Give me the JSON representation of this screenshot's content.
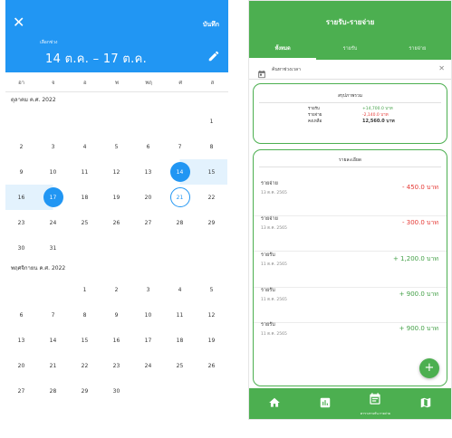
{
  "picker": {
    "header": {
      "close_glyph": "✕",
      "save_label": "บันทึก",
      "range_caption": "เลือกช่วง",
      "range_text": "14 ต.ค. – 17 ต.ค.",
      "edit_icon": "pencil-icon",
      "bg_color": "#2196f3"
    },
    "weekdays": [
      "อา",
      "จ",
      "อ",
      "พ",
      "พฤ",
      "ศ",
      "ส"
    ],
    "months": [
      {
        "title": "ตุลาคม ค.ศ. 2022",
        "lead_blanks": 6,
        "days": [
          "1",
          "2",
          "3",
          "4",
          "5",
          "6",
          "7",
          "8",
          "9",
          "10",
          "11",
          "12",
          "13",
          "14",
          "15",
          "16",
          "17",
          "18",
          "19",
          "20",
          "21",
          "22",
          "23",
          "24",
          "25",
          "26",
          "27",
          "28",
          "29",
          "30",
          "31"
        ]
      },
      {
        "title": "พฤศจิกายน ค.ศ. 2022",
        "lead_blanks": 2,
        "days": [
          "1",
          "2",
          "3",
          "4",
          "5",
          "6",
          "7",
          "8",
          "9",
          "10",
          "11",
          "12",
          "13",
          "14",
          "15",
          "16",
          "17",
          "18",
          "19",
          "20",
          "21",
          "22",
          "23",
          "24",
          "25",
          "26",
          "27",
          "28",
          "29",
          "30"
        ]
      }
    ],
    "selection": {
      "start_day": "14",
      "end_day": "17",
      "today": "21",
      "month_index": 0
    },
    "accent_color": "#2196f3"
  },
  "app": {
    "title": "รายรับ-รายจ่าย",
    "tabs": [
      "ทั้งหมด",
      "รายรับ",
      "รายจ่าย"
    ],
    "active_tab": 0,
    "search": {
      "icon": "calendar-icon",
      "label": "ค้นหาช่วงเวลา",
      "clear_glyph": "✕"
    },
    "summary": {
      "title": "สรุปภาพรวม",
      "rows": [
        {
          "label": "รายรับ",
          "value": "+14,700.0 บาท",
          "kind": "inc"
        },
        {
          "label": "รายจ่าย",
          "value": "-2,140.0 บาท",
          "kind": "exp"
        },
        {
          "label": "คงเหลือ",
          "value": "12,560.0 บาท",
          "kind": "bal"
        }
      ]
    },
    "details": {
      "title": "รายละเอียด",
      "items": [
        {
          "type": "รายจ่าย",
          "date": "13 ต.ค. 2565",
          "amount": "- 450.0 บาท",
          "kind": "expense"
        },
        {
          "type": "รายจ่าย",
          "date": "13 ต.ค. 2565",
          "amount": "- 300.0 บาท",
          "kind": "expense"
        },
        {
          "type": "รายรับ",
          "date": "11 ต.ค. 2565",
          "amount": "+ 1,200.0 บาท",
          "kind": "income"
        },
        {
          "type": "รายรับ",
          "date": "11 ต.ค. 2565",
          "amount": "+ 900.0 บาท",
          "kind": "income"
        },
        {
          "type": "รายรับ",
          "date": "11 ต.ค. 2565",
          "amount": "+ 900.0 บาท",
          "kind": "income"
        }
      ]
    },
    "fab_glyph": "+",
    "nav": [
      {
        "icon": "home-icon",
        "label": ""
      },
      {
        "icon": "bar-chart-icon",
        "label": ""
      },
      {
        "icon": "calendar-list-icon",
        "label": "ตารางรายรับ-รายจ่าย"
      },
      {
        "icon": "map-icon",
        "label": ""
      }
    ],
    "active_nav": 2,
    "colors": {
      "primary": "#4caf50",
      "income": "#43a047",
      "expense": "#e53935"
    }
  }
}
